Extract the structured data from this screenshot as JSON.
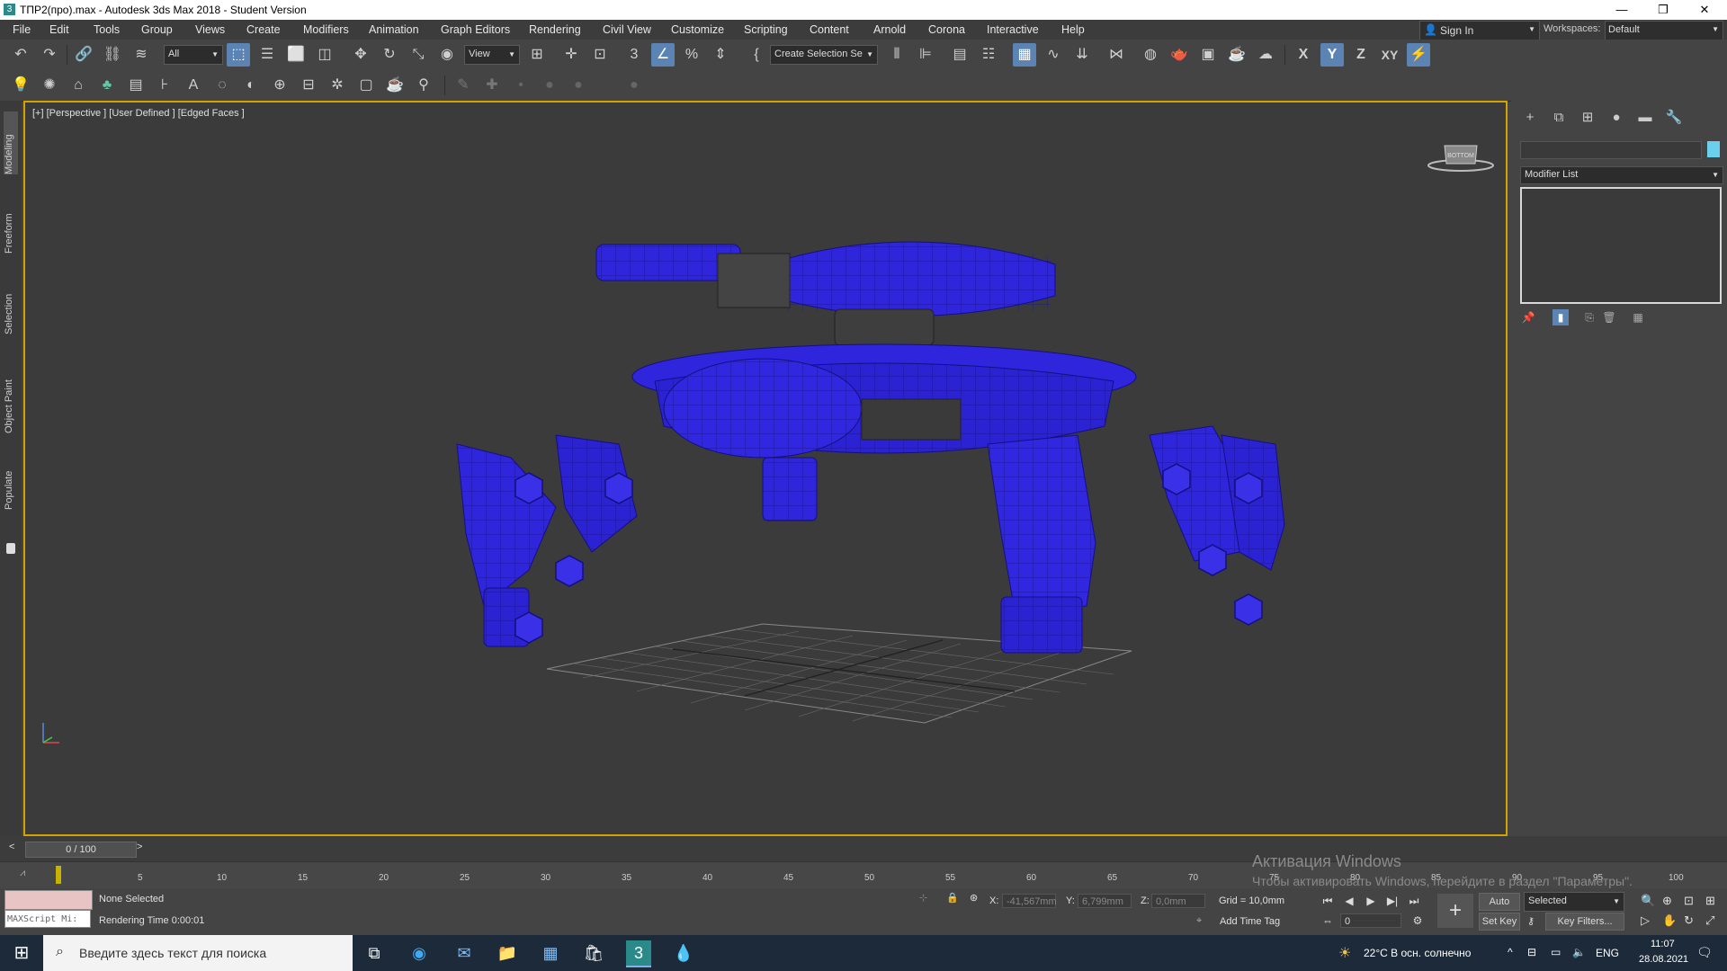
{
  "window": {
    "title": "ТПР2(про).max - Autodesk 3ds Max 2018 - Student Version",
    "minimize": "—",
    "restore": "❐",
    "close": "✕"
  },
  "menu": [
    "File",
    "Edit",
    "Tools",
    "Group",
    "Views",
    "Create",
    "Modifiers",
    "Animation",
    "Graph Editors",
    "Rendering",
    "Civil View",
    "Customize",
    "Scripting",
    "Content",
    "Arnold",
    "Corona",
    "Interactive",
    "Help"
  ],
  "signin": "Sign In",
  "workspaces_label": "Workspaces:",
  "workspace_value": "Default",
  "toolbar": {
    "filter_value": "All",
    "refcoord_value": "View",
    "selection_set_value": "Create Selection Se",
    "axis_x": "X",
    "axis_y": "Y",
    "axis_z": "Z",
    "axis_xy": "XY"
  },
  "left_tabs": [
    "Modeling",
    "Freeform",
    "Selection",
    "Object Paint",
    "Populate"
  ],
  "viewport": {
    "label": "[+] [Perspective ] [User Defined ] [Edged Faces ]",
    "viewcube_label": "BOTTOM",
    "model_color": "#2a1fd6"
  },
  "command_panel": {
    "modifier_list": "Modifier List"
  },
  "timeline": {
    "frame_display": "0 / 100",
    "ticks": [
      "5",
      "10",
      "15",
      "20",
      "25",
      "30",
      "35",
      "40",
      "45",
      "50",
      "55",
      "60",
      "65",
      "70",
      "75",
      "80",
      "85",
      "90",
      "95",
      "100"
    ]
  },
  "status": {
    "maxscript_placeholder": "MAXScript Mi:",
    "selection_text": "None Selected",
    "render_time": "Rendering Time  0:00:01",
    "x_label": "X:",
    "x_value": "-41,567mm",
    "y_label": "Y:",
    "y_value": "6,799mm",
    "z_label": "Z:",
    "z_value": "0,0mm",
    "grid": "Grid = 10,0mm",
    "add_time_tag": "Add Time Tag",
    "auto_key": "Auto Key",
    "set_key": "Set Key",
    "selected": "Selected",
    "key_filters": "Key Filters...",
    "frame_input": "0"
  },
  "watermark": {
    "line1": "Активация Windows",
    "line2": "Чтобы активировать Windows, перейдите в раздел \"Параметры\"."
  },
  "taskbar": {
    "search_placeholder": "Введите здесь текст для поиска",
    "weather": "22°C  В осн. солнечно",
    "lang": "ENG",
    "time": "11:07",
    "date": "28.08.2021"
  }
}
